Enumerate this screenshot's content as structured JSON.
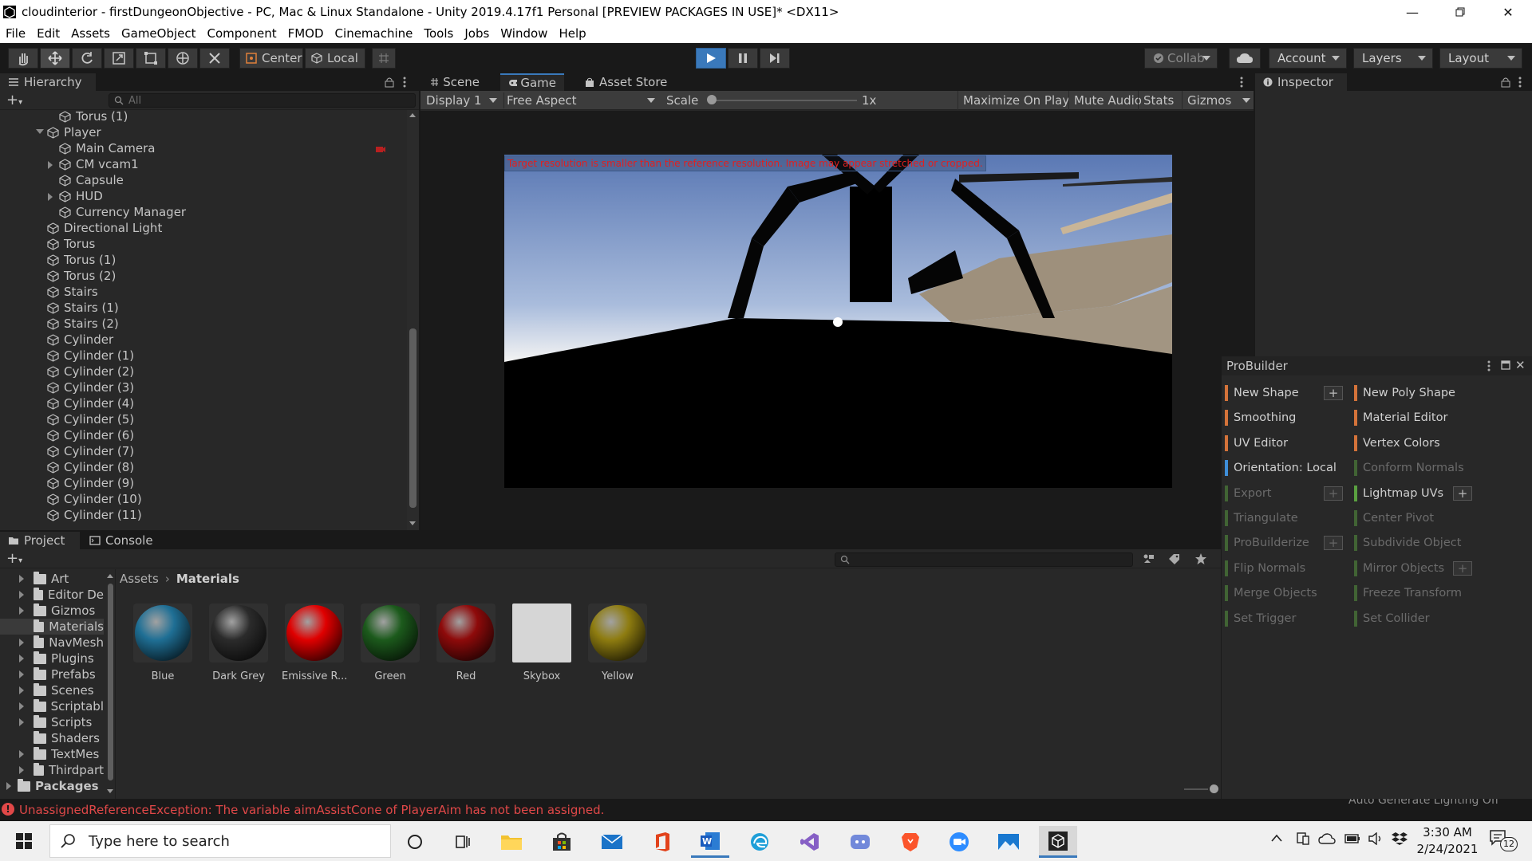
{
  "window": {
    "title": "cloudinterior - firstDungeonObjective - PC, Mac & Linux Standalone - Unity 2019.4.17f1 Personal [PREVIEW PACKAGES IN USE]* <DX11>"
  },
  "menu": [
    "File",
    "Edit",
    "Assets",
    "GameObject",
    "Component",
    "FMOD",
    "Cinemachine",
    "Tools",
    "Jobs",
    "Window",
    "Help"
  ],
  "toolbar": {
    "pivot_label": "Center",
    "space_label": "Local",
    "collab_label": "Collab",
    "account_label": "Account",
    "layers_label": "Layers",
    "layout_label": "Layout"
  },
  "hierarchy": {
    "tab_label": "Hierarchy",
    "search_placeholder": "All",
    "items": [
      "Torus (1)",
      "Player",
      "Main Camera",
      "CM vcam1",
      "Capsule",
      "HUD",
      "Currency Manager",
      "Directional Light",
      "Torus",
      "Torus (1)",
      "Torus (2)",
      "Stairs",
      "Stairs (1)",
      "Stairs (2)",
      "Cylinder",
      "Cylinder (1)",
      "Cylinder (2)",
      "Cylinder (3)",
      "Cylinder (4)",
      "Cylinder (5)",
      "Cylinder (6)",
      "Cylinder (7)",
      "Cylinder (8)",
      "Cylinder (9)",
      "Cylinder (10)",
      "Cylinder (11)"
    ]
  },
  "center_tabs": {
    "scene": "Scene",
    "game": "Game",
    "asset_store": "Asset Store"
  },
  "game_bar": {
    "display": "Display 1",
    "aspect": "Free Aspect",
    "scale_label": "Scale",
    "scale_value": "1x",
    "maximize": "Maximize On Play",
    "mute": "Mute Audio",
    "stats": "Stats",
    "gizmos": "Gizmos"
  },
  "game_view": {
    "warning": "Target resolution is smaller than the reference resolution. Image may appear stretched or cropped."
  },
  "inspector": {
    "tab_label": "Inspector"
  },
  "project": {
    "tab_label": "Project",
    "console_label": "Console",
    "folders": [
      "Art",
      "Editor De",
      "Gizmos",
      "Materials",
      "NavMesh",
      "Plugins",
      "Prefabs",
      "Scenes",
      "Scriptabl",
      "Scripts",
      "Shaders",
      "TextMes",
      "Thirdpart"
    ],
    "packages_label": "Packages",
    "breadcrumb": [
      "Assets",
      "Materials"
    ],
    "materials": [
      {
        "name": "Blue",
        "color": "#1f6f95"
      },
      {
        "name": "Dark Grey",
        "color": "#2b2b2b"
      },
      {
        "name": "Emissive R...",
        "color": "#e00000"
      },
      {
        "name": "Green",
        "color": "#1c5a1c"
      },
      {
        "name": "Red",
        "color": "#8e0a0a"
      },
      {
        "name": "Skybox",
        "color": "#d6d6d6"
      },
      {
        "name": "Yellow",
        "color": "#8e7c10"
      }
    ]
  },
  "probuilder": {
    "title": "ProBuilder",
    "left": [
      {
        "label": "New Shape",
        "color": "#d4733a",
        "plus": true,
        "enabled": true
      },
      {
        "label": "Smoothing",
        "color": "#d4733a",
        "plus": false,
        "enabled": true
      },
      {
        "label": "UV Editor",
        "color": "#d4733a",
        "plus": false,
        "enabled": true
      },
      {
        "label": "Orientation: Local",
        "color": "#3e8ed8",
        "plus": false,
        "enabled": true
      },
      {
        "label": "Export",
        "color": "#5aa040",
        "plus": true,
        "enabled": false
      },
      {
        "label": "Triangulate",
        "color": "#5aa040",
        "plus": false,
        "enabled": false
      },
      {
        "label": "ProBuilderize",
        "color": "#5aa040",
        "plus": true,
        "enabled": false
      },
      {
        "label": "Flip Normals",
        "color": "#5aa040",
        "plus": false,
        "enabled": false
      },
      {
        "label": "Merge Objects",
        "color": "#5aa040",
        "plus": false,
        "enabled": false
      },
      {
        "label": "Set Trigger",
        "color": "#5aa040",
        "plus": false,
        "enabled": false
      }
    ],
    "right": [
      {
        "label": "New Poly Shape",
        "color": "#d4733a",
        "plus": false,
        "enabled": true
      },
      {
        "label": "Material Editor",
        "color": "#d4733a",
        "plus": false,
        "enabled": true
      },
      {
        "label": "Vertex Colors",
        "color": "#d4733a",
        "plus": false,
        "enabled": true
      },
      {
        "label": "Conform Normals",
        "color": "#5aa040",
        "plus": false,
        "enabled": false
      },
      {
        "label": "Lightmap UVs",
        "color": "#5aa040",
        "plus": true,
        "enabled": true
      },
      {
        "label": "Center Pivot",
        "color": "#5aa040",
        "plus": false,
        "enabled": false
      },
      {
        "label": "Subdivide Object",
        "color": "#5aa040",
        "plus": false,
        "enabled": false
      },
      {
        "label": "Mirror Objects",
        "color": "#5aa040",
        "plus": true,
        "enabled": false
      },
      {
        "label": "Freeze Transform",
        "color": "#5aa040",
        "plus": false,
        "enabled": false
      },
      {
        "label": "Set Collider",
        "color": "#5aa040",
        "plus": false,
        "enabled": false
      }
    ]
  },
  "status": {
    "error": "UnassignedReferenceException: The variable aimAssistCone of PlayerAim has not been assigned.",
    "right_text": "Auto Generate Lighting Off"
  },
  "taskbar": {
    "search_placeholder": "Type here to search",
    "time": "3:30 AM",
    "date": "2/24/2021",
    "notification_count": "12"
  },
  "colors": {
    "accent": "#3a79bb",
    "error": "#e04848",
    "panel": "#282828"
  }
}
